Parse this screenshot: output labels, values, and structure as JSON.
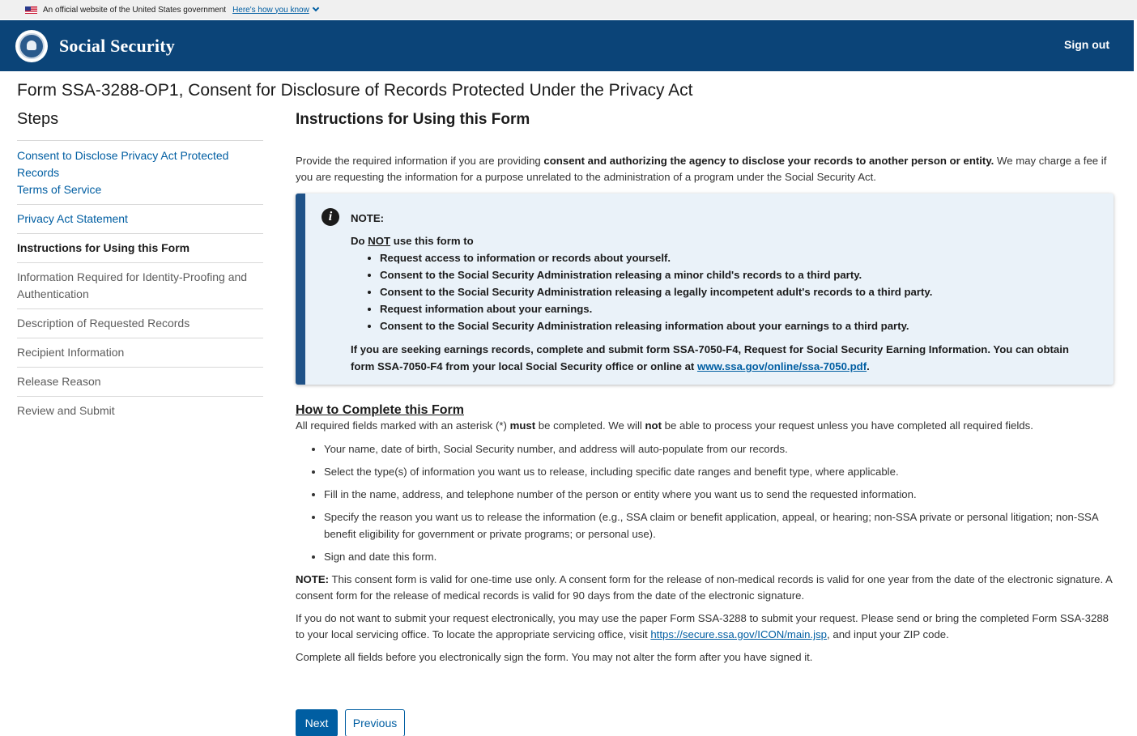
{
  "gov_banner": {
    "text": "An official website of the United States government",
    "link": "Here's how you know"
  },
  "header": {
    "brand": "Social Security",
    "sign_out": "Sign out"
  },
  "page_title": "Form SSA-3288-OP1, Consent for Disclosure of Records Protected Under the Privacy Act",
  "sidebar": {
    "title": "Steps",
    "items": [
      {
        "label": "Consent to Disclose Privacy Act Protected Records",
        "state": "link"
      },
      {
        "label": "Terms of Service",
        "state": "link"
      },
      {
        "label": "Privacy Act Statement",
        "state": "link"
      },
      {
        "label": "Instructions for Using this Form",
        "state": "current"
      },
      {
        "label": "Information Required for Identity-Proofing and Authentication",
        "state": "future"
      },
      {
        "label": "Description of Requested Records",
        "state": "future"
      },
      {
        "label": "Recipient Information",
        "state": "future"
      },
      {
        "label": "Release Reason",
        "state": "future"
      },
      {
        "label": "Review and Submit",
        "state": "future"
      }
    ]
  },
  "main": {
    "heading": "Instructions for Using this Form",
    "intro_1": "Provide the required information if you are providing ",
    "intro_bold": "consent and authorizing the agency to disclose your records to another person or entity.",
    "intro_2": " We may charge a fee if you are requesting the information for a purpose unrelated to the administration of a program under the Social Security Act.",
    "note": {
      "label": "NOTE:",
      "do_prefix": "Do ",
      "do_not": "NOT",
      "do_suffix": " use this form to",
      "items": [
        "Request access to information or records about yourself.",
        "Consent to the Social Security Administration releasing a minor child's records to a third party.",
        "Consent to the Social Security Administration releasing a legally incompetent adult's records to a third party.",
        "Request information about your earnings.",
        "Consent to the Social Security Administration releasing information about your earnings to a third party."
      ],
      "tail": "If you are seeking earnings records, complete and submit form SSA-7050-F4, Request for Social Security Earning Information.  You can obtain form SSA-7050-F4 from your local Social Security office or online at ",
      "tail_link": "www.ssa.gov/online/ssa-7050.pdf",
      "tail_end": "."
    },
    "how": {
      "title": "How to Complete this Form",
      "req_1": "All required fields marked with an asterisk (*) ",
      "req_must": "must",
      "req_2": " be completed. We will ",
      "req_not": "not",
      "req_3": " be able to process your request unless you have completed all required fields.",
      "items": [
        "Your name, date of birth, Social Security number, and address will auto-populate from our records.",
        "Select the type(s) of information you want us to release, including specific date ranges and benefit type, where applicable.",
        "Fill in the name, address, and telephone number of the person or entity where you want us to send the requested information.",
        "Specify the reason you want us to release the information (e.g., SSA claim or benefit application, appeal, or hearing; non-SSA private or personal litigation; non-SSA benefit eligibility for government or private programs; or personal use).",
        "Sign and date this form."
      ],
      "note_label": "NOTE:",
      "note_text": "  This consent form is valid for one-time use only. A consent form for the release of non-medical records is valid for one year from the date of the electronic signature. A consent form for the release of medical records is valid for 90 days from the date of the electronic signature.",
      "paper_1": "If you do not want to submit your request electronically, you may use the paper Form SSA-3288 to submit your request. Please send or bring the completed Form SSA-3288 to your local servicing office. To locate the appropriate servicing office, visit ",
      "paper_link": "https://secure.ssa.gov/ICON/main.jsp",
      "paper_2": ", and input your ZIP code.",
      "final": "Complete all fields before you electronically sign the form. You may not alter the form after you have signed it."
    }
  },
  "buttons": {
    "next": "Next",
    "previous": "Previous"
  }
}
